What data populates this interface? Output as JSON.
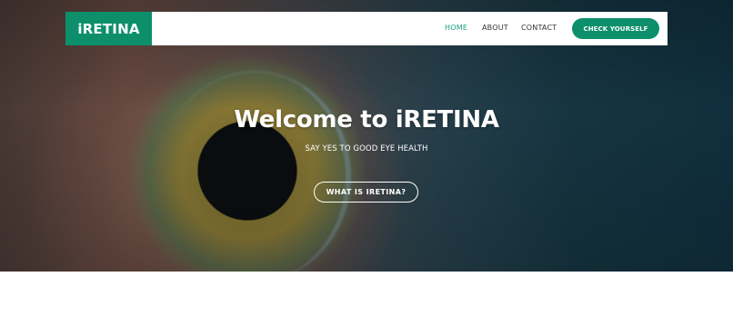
{
  "header": {
    "logo_text": "iRETINA",
    "nav": {
      "home": "HOME",
      "about": "ABOUT",
      "contact": "CONTACT"
    },
    "cta_label": "CHECK YOURSELF"
  },
  "hero": {
    "title": "Welcome to iRETINA",
    "subtitle": "SAY YES TO GOOD EYE HEALTH",
    "button_label": "WHAT IS IRETINA?"
  },
  "colors": {
    "brand_green": "#0d8f6c",
    "active_link": "#17a07b"
  }
}
